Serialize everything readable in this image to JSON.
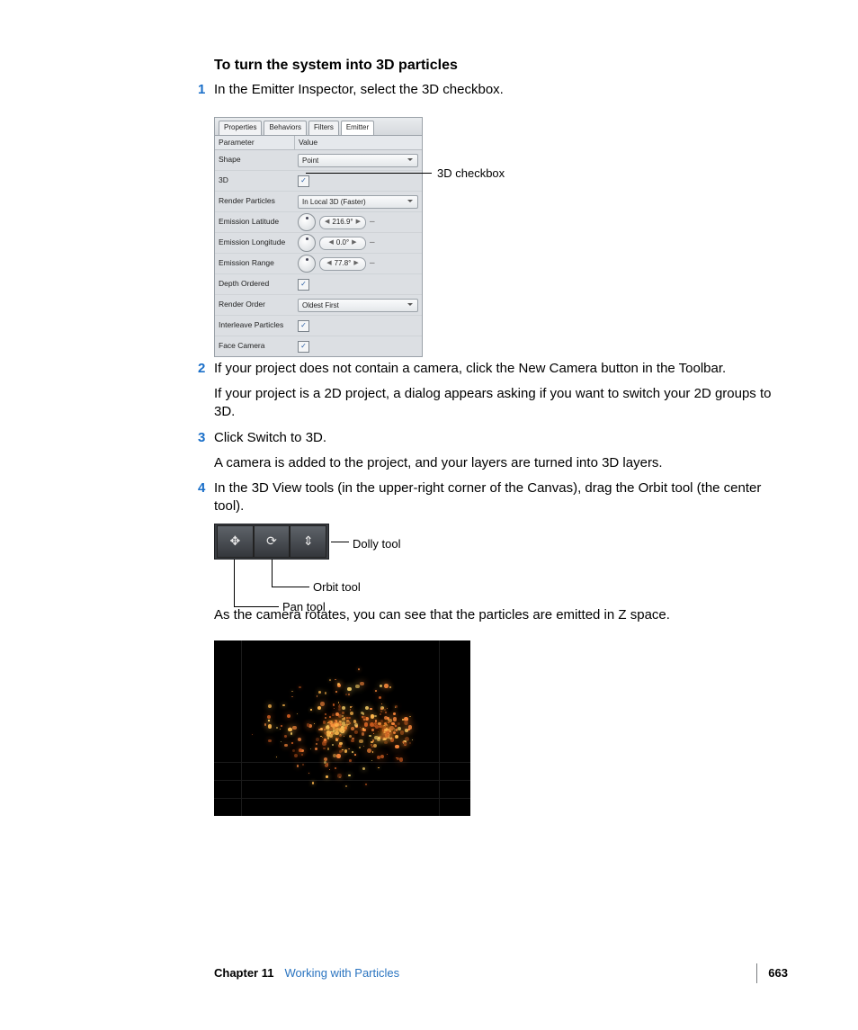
{
  "heading": "To turn the system into 3D particles",
  "steps": {
    "s1_text": "In the Emitter Inspector, select the 3D checkbox.",
    "s2_text": "If your project does not contain a camera, click the New Camera button in the Toolbar.",
    "s2_follow": "If your project is a 2D project, a dialog appears asking if you want to switch your 2D groups to 3D.",
    "s3_text": "Click Switch to 3D.",
    "s3_follow": "A camera is added to the project, and your layers are turned into 3D layers.",
    "s4_text": "In the 3D View tools (in the upper-right corner of the Canvas), drag the Orbit tool (the center tool)."
  },
  "after_viewtools": "As the camera rotates, you can see that the particles are emitted in Z space.",
  "inspector": {
    "tabs": {
      "t1": "Properties",
      "t2": "Behaviors",
      "t3": "Filters",
      "t4": "Emitter"
    },
    "header_param": "Parameter",
    "header_value": "Value",
    "rows": {
      "shape": "Shape",
      "shape_val": "Point",
      "threeD": "3D",
      "render_particles": "Render Particles",
      "render_particles_val": "In Local 3D (Faster)",
      "em_lat": "Emission Latitude",
      "em_lat_val": "216.9°",
      "em_lon": "Emission Longitude",
      "em_lon_val": "0.0°",
      "em_range": "Emission Range",
      "em_range_val": "77.8°",
      "depth_ordered": "Depth Ordered",
      "render_order": "Render Order",
      "render_order_val": "Oldest First",
      "interleave": "Interleave Particles",
      "face_camera": "Face Camera"
    },
    "callout": "3D checkbox"
  },
  "viewtools": {
    "dolly": "Dolly tool",
    "orbit": "Orbit tool",
    "pan": "Pan tool"
  },
  "footer": {
    "chapter": "Chapter 11",
    "title": "Working with Particles",
    "page": "663"
  }
}
